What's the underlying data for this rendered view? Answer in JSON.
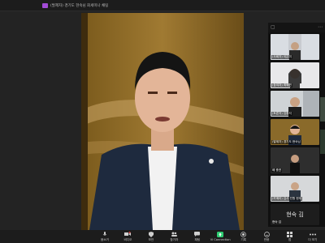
{
  "window": {
    "title": "(발제자) 경기도 현숙님 회세미나 채팅",
    "title_icon_color": "#a24bd6"
  },
  "main_speaker": {
    "description_icon": "speaker-video"
  },
  "gallery": {
    "tiles": [
      {
        "name": "(사회자) 이은미"
      },
      {
        "name": "(참여자) 최혜연"
      },
      {
        "name": "(토론자) 임종석"
      },
      {
        "name": "(발제자) 경기도 현숙님"
      },
      {
        "name": "배 충권"
      },
      {
        "name": "(카메라) 김사 민원 현재"
      },
      {
        "name": "현숙 김",
        "big": "현숙 김"
      }
    ]
  },
  "toolbar": {
    "items": [
      {
        "label": "음소거",
        "icon": "microphone-icon"
      },
      {
        "label": "비디오",
        "icon": "video-icon"
      },
      {
        "label": "보안",
        "icon": "shield-icon"
      },
      {
        "label": "참가자",
        "icon": "participants-icon"
      },
      {
        "label": "채팅",
        "icon": "chat-icon"
      },
      {
        "label": "Vi Connection",
        "icon": "share-screen-icon"
      },
      {
        "label": "기록",
        "icon": "record-icon"
      },
      {
        "label": "반응",
        "icon": "reaction-icon"
      },
      {
        "label": "앱",
        "icon": "apps-icon"
      },
      {
        "label": "더 보기",
        "icon": "more-icon"
      }
    ],
    "accent": "#2ecc71"
  }
}
